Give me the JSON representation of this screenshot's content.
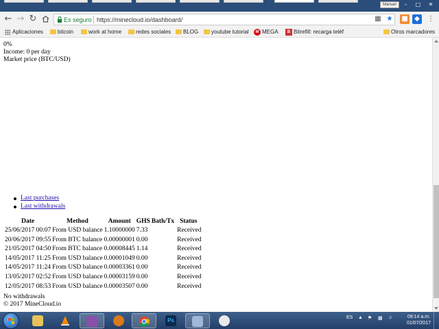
{
  "browser": {
    "profile_name": "Manuel",
    "secure_label": "Es seguro",
    "url": "https://minecloud.io/dashboard/",
    "bookmarks": [
      {
        "label": "Aplicaciones",
        "icon": "apps-grid-icon"
      },
      {
        "label": "bitcoin",
        "icon": "folder-icon"
      },
      {
        "label": "work at home",
        "icon": "folder-icon"
      },
      {
        "label": "redes sociales",
        "icon": "folder-icon"
      },
      {
        "label": "BLOG",
        "icon": "folder-icon"
      },
      {
        "label": "youtube tutorial",
        "icon": "folder-icon"
      },
      {
        "label": "MEGA",
        "icon": "mega-icon"
      },
      {
        "label": "Bitrefill: recarga teléf",
        "icon": "bitrefill-icon"
      },
      {
        "label": "Otros marcadores",
        "icon": "folder-icon"
      }
    ]
  },
  "page": {
    "percent": "0%",
    "income": "Income: 0 per day",
    "market": "Market price (BTC/USD)",
    "links": [
      "Last purchases",
      "Last withdrawals"
    ],
    "table_headers": [
      "Date",
      "Method",
      "Amount",
      "GHS",
      "Bath/Tx",
      "Status"
    ],
    "rows": [
      [
        "25/06/2017 00:07",
        "From USD balance",
        "1.10000000",
        "7.33",
        "",
        "Received"
      ],
      [
        "20/06/2017 09:55",
        "From BTC balance",
        "0.00000001",
        "0.00",
        "",
        "Received"
      ],
      [
        "21/05/2017 04:50",
        "From BTC balance",
        "0.00008445",
        "1.14",
        "",
        "Received"
      ],
      [
        "14/05/2017 11:25",
        "From USD balance",
        "0.00001049",
        "0.00",
        "",
        "Received"
      ],
      [
        "14/05/2017 11:24",
        "From USD balance",
        "0.00003361",
        "0.00",
        "",
        "Received"
      ],
      [
        "13/05/2017 02:52",
        "From USD balance",
        "0.00003159",
        "0.00",
        "",
        "Received"
      ],
      [
        "12/05/2017 08:53",
        "From USD balance",
        "0.00003507",
        "0.00",
        "",
        "Received"
      ]
    ],
    "no_withdrawals": "No withdrawals",
    "copyright": "© 2017 MineCloud.io"
  },
  "taskbar": {
    "apps": [
      "file-explorer-icon",
      "vlc-icon",
      "winrar-icon",
      "bitcoin-wallet-icon",
      "chrome-icon",
      "photoshop-icon",
      "network-app-icon",
      "paint-icon"
    ],
    "photoshop_label": "Ps",
    "language": "ES",
    "time": "09:14 a.m.",
    "date": "01/07/2017"
  },
  "colors": {
    "link": "#1a0dab",
    "secure_green": "#188038",
    "taskbar": "#2f5180"
  }
}
